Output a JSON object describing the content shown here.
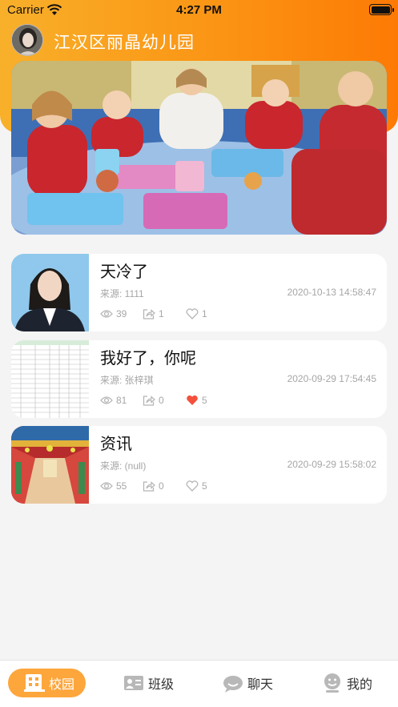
{
  "status_bar": {
    "carrier": "Carrier",
    "time": "4:27 PM"
  },
  "header": {
    "school_name": "江汉区丽晶幼儿园"
  },
  "news": [
    {
      "title": "天冷了",
      "source": "来源: 1111",
      "date": "2020-10-13 14:58:47",
      "views": "39",
      "shares": "1",
      "likes": "1",
      "liked": false
    },
    {
      "title": "我好了，你呢",
      "source": "来源: 张梓琪",
      "date": "2020-09-29 17:54:45",
      "views": "81",
      "shares": "0",
      "likes": "5",
      "liked": true
    },
    {
      "title": "资讯",
      "source": "来源: (null)",
      "date": "2020-09-29 15:58:02",
      "views": "55",
      "shares": "0",
      "likes": "5",
      "liked": false
    }
  ],
  "tabbar": {
    "tabs": [
      {
        "label": "校园"
      },
      {
        "label": "班级"
      },
      {
        "label": "聊天"
      },
      {
        "label": "我的"
      }
    ]
  },
  "colors": {
    "accent": "#fd7a05",
    "tab_active": "#fda63c",
    "liked": "#f4503c"
  }
}
